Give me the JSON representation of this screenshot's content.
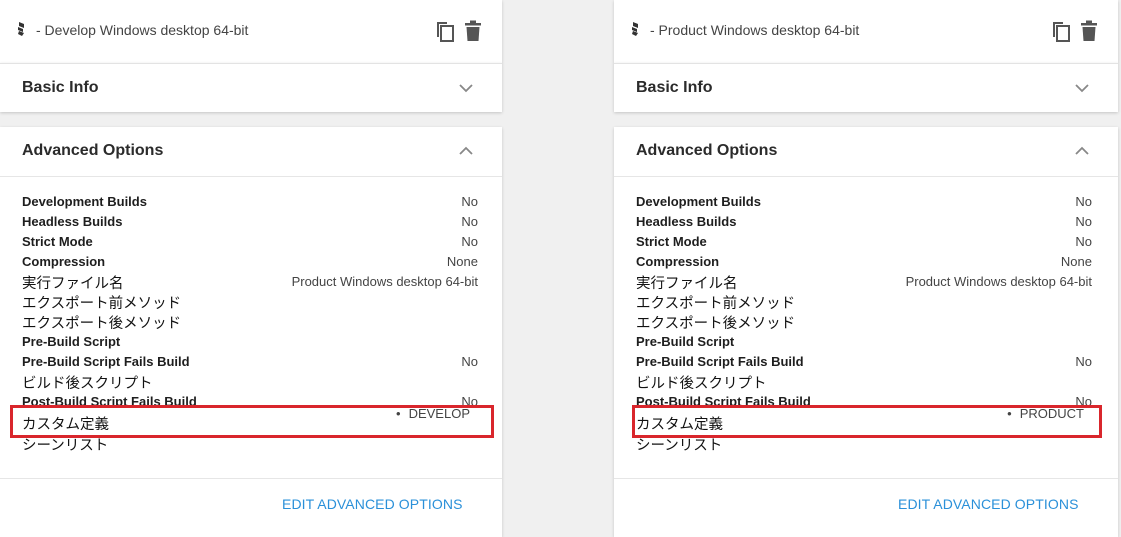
{
  "panels": [
    {
      "title": "- Develop Windows desktop 64-bit",
      "basic_info": {
        "label": "Basic Info"
      },
      "advanced": {
        "label": "Advanced Options",
        "rows": [
          {
            "key": "Development Builds",
            "value": "No"
          },
          {
            "key": "Headless Builds",
            "value": "No"
          },
          {
            "key": "Strict Mode",
            "value": "No"
          },
          {
            "key": "Compression",
            "value": "None"
          },
          {
            "key": "実行ファイル名",
            "value": "Product Windows desktop 64-bit"
          },
          {
            "key": "エクスポート前メソッド",
            "value": ""
          },
          {
            "key": "エクスポート後メソッド",
            "value": ""
          },
          {
            "key": "Pre-Build Script",
            "value": ""
          },
          {
            "key": "Pre-Build Script Fails Build",
            "value": "No"
          },
          {
            "key": "ビルド後スクリプト",
            "value": ""
          },
          {
            "key": "Post-Build Script Fails Build",
            "value": "No"
          },
          {
            "key": "カスタム定義",
            "value": "DEVELOP",
            "bullet": "•"
          },
          {
            "key": "シーンリスト",
            "value": ""
          }
        ],
        "edit_label": "EDIT ADVANCED OPTIONS"
      }
    },
    {
      "title": "- Product Windows desktop 64-bit",
      "basic_info": {
        "label": "Basic Info"
      },
      "advanced": {
        "label": "Advanced Options",
        "rows": [
          {
            "key": "Development Builds",
            "value": "No"
          },
          {
            "key": "Headless Builds",
            "value": "No"
          },
          {
            "key": "Strict Mode",
            "value": "No"
          },
          {
            "key": "Compression",
            "value": "None"
          },
          {
            "key": "実行ファイル名",
            "value": "Product Windows desktop 64-bit"
          },
          {
            "key": "エクスポート前メソッド",
            "value": ""
          },
          {
            "key": "エクスポート後メソッド",
            "value": ""
          },
          {
            "key": "Pre-Build Script",
            "value": ""
          },
          {
            "key": "Pre-Build Script Fails Build",
            "value": "No"
          },
          {
            "key": "ビルド後スクリプト",
            "value": ""
          },
          {
            "key": "Post-Build Script Fails Build",
            "value": "No"
          },
          {
            "key": "カスタム定義",
            "value": "PRODUCT",
            "bullet": "•"
          },
          {
            "key": "シーンリスト",
            "value": ""
          }
        ],
        "edit_label": "EDIT ADVANCED OPTIONS"
      }
    }
  ],
  "icons": {
    "unity": "unity-logo-icon",
    "copy": "copy-icon",
    "delete": "trash-icon",
    "collapse": "chevron-up-icon",
    "expand": "chevron-down-icon"
  },
  "colors": {
    "highlight": "#d9262c",
    "link": "#2a90d9",
    "background": "#f0f0f0"
  }
}
